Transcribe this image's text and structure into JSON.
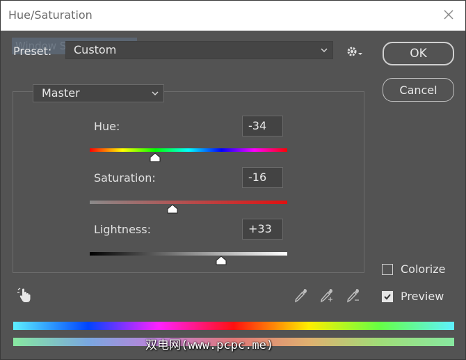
{
  "window": {
    "title": "Hue/Saturation",
    "ghost_text": "Window Snip",
    "watermark": "双电网(www.pcpc.me)"
  },
  "preset": {
    "label": "Preset:",
    "value": "Custom"
  },
  "buttons": {
    "ok": "OK",
    "cancel": "Cancel"
  },
  "channel": {
    "value": "Master"
  },
  "sliders": {
    "hue": {
      "label": "Hue:",
      "value": "-34",
      "position": 0.33
    },
    "saturation": {
      "label": "Saturation:",
      "value": "-16",
      "position": 0.42
    },
    "lightness": {
      "label": "Lightness:",
      "value": "+33",
      "position": 0.665
    }
  },
  "options": {
    "colorize": {
      "label": "Colorize",
      "checked": false
    },
    "preview": {
      "label": "Preview",
      "checked": true
    }
  },
  "icons": {
    "close": "close-icon",
    "gear": "gear-icon",
    "hand": "hand-adjust-icon",
    "eyedropper": "eyedropper-icon",
    "eyedropper_add": "eyedropper-add-icon",
    "eyedropper_subtract": "eyedropper-subtract-icon"
  },
  "colors": {
    "dialog_bg": "#535353",
    "titlebar_bg": "#ffffff"
  }
}
